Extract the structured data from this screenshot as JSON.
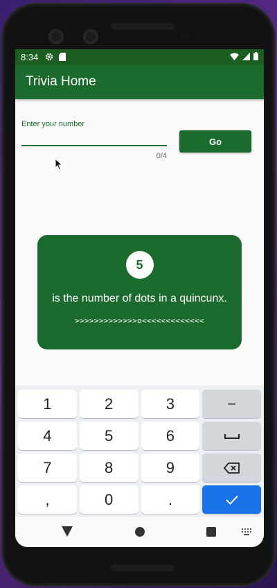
{
  "status": {
    "time": "8:34",
    "icons": [
      "gear-icon",
      "sd-card-icon",
      "wifi-icon",
      "signal-icon",
      "battery-icon"
    ]
  },
  "appbar": {
    "title": "Trivia Home"
  },
  "number_input": {
    "label": "Enter your number",
    "value": "",
    "counter": "0/4"
  },
  "go_button": {
    "label": "Go"
  },
  "trivia_card": {
    "number": "5",
    "fact": "is the number of dots in a quincunx.",
    "decoration": ">>>>>>>>>>>>>o<<<<<<<<<<<<<"
  },
  "keyboard": {
    "rows": [
      [
        "1",
        "2",
        "3",
        "−"
      ],
      [
        "4",
        "5",
        "6",
        "␣"
      ],
      [
        "7",
        "8",
        "9",
        "⌫"
      ],
      [
        ",",
        "0",
        ".",
        "✓"
      ]
    ]
  },
  "navigation": {
    "icons": [
      "back-icon",
      "home-icon",
      "recents-icon",
      "keyboard-icon"
    ]
  },
  "colors": {
    "primary": "#1b6a2e",
    "statusbar": "#1b5e20",
    "keyboard_accent": "#1a73e8"
  }
}
